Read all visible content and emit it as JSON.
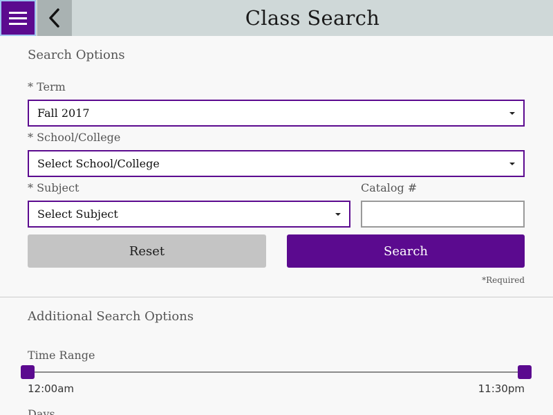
{
  "header": {
    "title": "Class Search",
    "menu_icon": "hamburger-icon",
    "back_icon": "chevron-left-icon"
  },
  "search_options": {
    "heading": "Search Options",
    "term": {
      "label": "* Term",
      "value": "Fall 2017"
    },
    "school": {
      "label": "* School/College",
      "value": "Select School/College"
    },
    "subject": {
      "label": "* Subject",
      "value": "Select Subject"
    },
    "catalog": {
      "label": "Catalog #",
      "value": ""
    },
    "reset_label": "Reset",
    "search_label": "Search",
    "required_note": "*Required"
  },
  "additional": {
    "heading": "Additional Search Options",
    "time_range": {
      "label": "Time Range",
      "start": "12:00am",
      "end": "11:30pm"
    },
    "days_label": "Days"
  },
  "colors": {
    "accent": "#5b0a8f",
    "header_bg": "#cfd8d8",
    "reset_bg": "#c4c4c4"
  }
}
